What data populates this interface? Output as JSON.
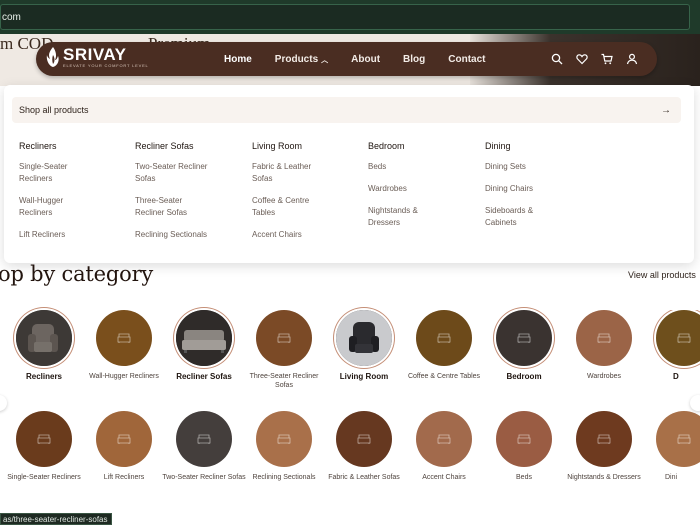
{
  "browser": {
    "url_fragment": "com"
  },
  "hero": {
    "left_text": "m COD",
    "right_text": "Premium"
  },
  "brand": {
    "name": "SRIVAY",
    "tagline": "ELEVATE YOUR COMFORT LEVEL"
  },
  "nav": {
    "links": [
      "Home",
      "Products",
      "About",
      "Blog",
      "Contact"
    ],
    "active": "Home",
    "icons": [
      "search-icon",
      "heart-icon",
      "cart-icon",
      "user-icon"
    ]
  },
  "mega_menu": {
    "shop_all": "Shop all products",
    "arrow": "→",
    "columns": [
      {
        "heading": "Recliners",
        "items": [
          "Single-Seater Recliners",
          "Wall-Hugger Recliners",
          "Lift Recliners"
        ]
      },
      {
        "heading": "Recliner Sofas",
        "items": [
          "Two-Seater Recliner Sofas",
          "Three-Seater Recliner Sofas",
          "Reclining Sectionals"
        ]
      },
      {
        "heading": "Living Room",
        "items": [
          "Fabric & Leather Sofas",
          "Coffee & Centre Tables",
          "Accent Chairs"
        ]
      },
      {
        "heading": "Bedroom",
        "items": [
          "Beds",
          "Wardrobes",
          "Nightstands & Dressers"
        ]
      },
      {
        "heading": "Dining",
        "items": [
          "Dining Sets",
          "Dining Chairs",
          "Sideboards & Cabinets"
        ]
      }
    ]
  },
  "categories": {
    "title": "op by category",
    "view_all": "View all products",
    "row1": [
      {
        "label": "Recliners",
        "color": "#4a4644",
        "style": "photo-recliner",
        "bold": true
      },
      {
        "label": "Wall-Hugger Recliners",
        "color": "#7a4f1c",
        "bold": false
      },
      {
        "label": "Recliner Sofas",
        "color": "#3b3634",
        "style": "photo-sofa",
        "bold": true
      },
      {
        "label": "Three-Seater Recliner Sofas",
        "color": "#7b4a26",
        "bold": false
      },
      {
        "label": "Living Room",
        "color": "#2f2d2f",
        "style": "photo-armchair",
        "bold": true
      },
      {
        "label": "Coffee & Centre Tables",
        "color": "#6d4a1a",
        "bold": false
      },
      {
        "label": "Bedroom",
        "color": "#3a3330",
        "bold": true
      },
      {
        "label": "Wardrobes",
        "color": "#9b6447",
        "bold": false
      },
      {
        "label": "D",
        "color": "#6e4f1c",
        "bold": true
      }
    ],
    "row2": [
      {
        "label": "Single-Seater Recliners",
        "color": "#6a3b1c"
      },
      {
        "label": "Lift Recliners",
        "color": "#a0663a"
      },
      {
        "label": "Two-Seater Recliner Sofas",
        "color": "#443e3c"
      },
      {
        "label": "Reclining Sectionals",
        "color": "#a9704a"
      },
      {
        "label": "Fabric & Leather Sofas",
        "color": "#663820"
      },
      {
        "label": "Accent Chairs",
        "color": "#a26a4c"
      },
      {
        "label": "Beds",
        "color": "#9a5c43"
      },
      {
        "label": "Nightstands & Dressers",
        "color": "#6e3a1f"
      },
      {
        "label": "Dini",
        "color": "#a87048"
      }
    ]
  },
  "status_bar": {
    "link": "as/three-seater-recliner-sofas"
  },
  "colors": {
    "nav_bg": "#4a2d22",
    "accent_ring": "#c48e76",
    "shop_all_bg": "#f8f3ef"
  }
}
